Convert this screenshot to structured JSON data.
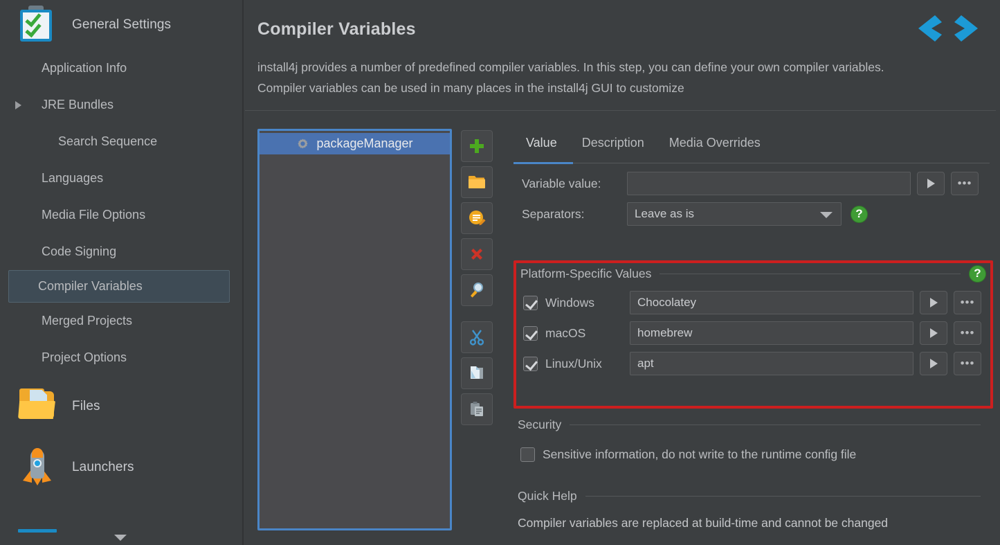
{
  "sidebar": {
    "group": {
      "icon": "clipboard-checks-icon",
      "label": "General Settings"
    },
    "items": [
      {
        "label": "Application Info",
        "indent": 1,
        "selected": false,
        "caret": false
      },
      {
        "label": "JRE Bundles",
        "indent": 1,
        "selected": false,
        "caret": true
      },
      {
        "label": "Search Sequence",
        "indent": 2,
        "selected": false,
        "caret": false
      },
      {
        "label": "Languages",
        "indent": 1,
        "selected": false,
        "caret": false
      },
      {
        "label": "Media File Options",
        "indent": 1,
        "selected": false,
        "caret": false
      },
      {
        "label": "Code Signing",
        "indent": 1,
        "selected": false,
        "caret": false
      },
      {
        "label": "Compiler Variables",
        "indent": 1,
        "selected": true,
        "caret": false
      },
      {
        "label": "Merged Projects",
        "indent": 1,
        "selected": false,
        "caret": false
      },
      {
        "label": "Project Options",
        "indent": 1,
        "selected": false,
        "caret": false
      }
    ],
    "icon_items": [
      {
        "icon": "folder-files-icon",
        "label": "Files"
      },
      {
        "icon": "rocket-icon",
        "label": "Launchers"
      }
    ],
    "scroll_down_icon": "chevron-down-icon",
    "progress_accent": "#1a8ac4"
  },
  "header": {
    "title": "Compiler Variables",
    "description": "install4j provides a number of predefined compiler variables. In this step, you can define your own compiler variables. Compiler variables can be used in many places in the install4j GUI to customize",
    "prev_icon": "chevron-left-icon",
    "next_icon": "chevron-right-icon",
    "nav_accent": "#1c9ad6"
  },
  "list_panel": {
    "items": [
      {
        "icon": "gear-icon",
        "label": "packageManager",
        "selected": true
      }
    ],
    "selection_color": "#4a72b0",
    "focus_border_color": "#4a86c8"
  },
  "toolbar": {
    "buttons": [
      {
        "name": "add-button",
        "icon": "plus-icon"
      },
      {
        "name": "open-folder-button",
        "icon": "folder-icon"
      },
      {
        "name": "edit-comment-button",
        "icon": "comment-edit-icon"
      },
      {
        "name": "delete-button",
        "icon": "red-x-icon"
      },
      {
        "name": "search-button",
        "icon": "magnifier-icon"
      },
      {
        "name": "cut-button",
        "icon": "scissors-icon"
      },
      {
        "name": "copy-button",
        "icon": "copy-pages-icon"
      },
      {
        "name": "paste-button",
        "icon": "clipboard-paste-icon"
      }
    ]
  },
  "tabs": [
    {
      "label": "Value",
      "active": true
    },
    {
      "label": "Description",
      "active": false
    },
    {
      "label": "Media Overrides",
      "active": false
    }
  ],
  "value_tab": {
    "variable_value_label": "Variable value:",
    "variable_value": "",
    "variable_value_placeholder": "",
    "separators_label": "Separators:",
    "separators_value": "Leave as is",
    "separators_options": [
      "Leave as is"
    ],
    "expand_icon": "play-triangle-icon",
    "browse_icon": "ellipsis-icon",
    "help_icon": "question-mark-icon"
  },
  "platform_section": {
    "title": "Platform-Specific Values",
    "help_icon": "question-mark-icon",
    "highlight_color": "#cc1f1f",
    "rows": [
      {
        "name": "Windows",
        "checked": true,
        "value": "Chocolatey"
      },
      {
        "name": "macOS",
        "checked": true,
        "value": "homebrew"
      },
      {
        "name": "Linux/Unix",
        "checked": true,
        "value": "apt"
      }
    ]
  },
  "security_section": {
    "title": "Security",
    "checkbox_label": "Sensitive information, do not write to the runtime config file",
    "checked": false
  },
  "quick_help_section": {
    "title": "Quick Help",
    "text": "Compiler variables are replaced at build-time and cannot be changed"
  }
}
